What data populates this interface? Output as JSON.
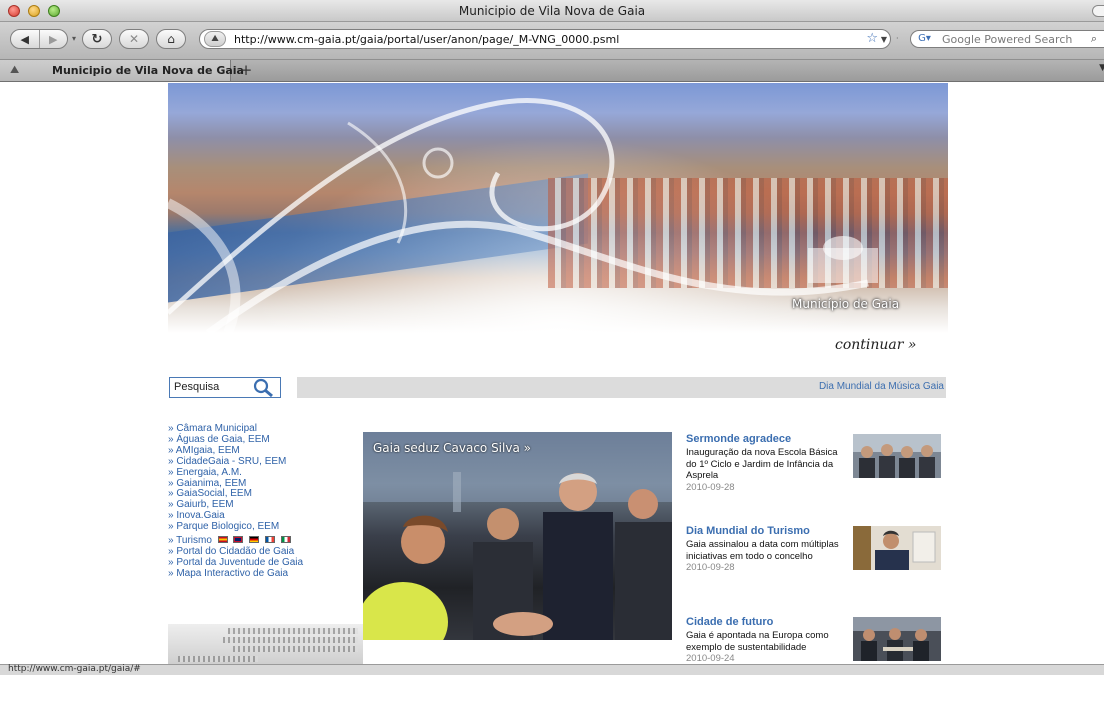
{
  "window": {
    "title": "Municipio de Vila Nova de Gaia",
    "url": "http://www.cm-gaia.pt/gaia/portal/user/anon/page/_M-VNG_0000.psml",
    "search_placeholder": "Google Powered Search",
    "tab_label": "Municipio de Vila Nova de Gaia",
    "new_tab": "+",
    "status": "http://www.cm-gaia.pt/gaia/#"
  },
  "page": {
    "hero_caption": "Município de Gaia",
    "continue_label": "continuar »",
    "search_value": "Pesquisa",
    "ticker": "Dia Mundial da Música  Gaia",
    "nav": [
      "» Câmara Municipal",
      "» Águas de Gaia, EEM",
      "» AMIgaia, EEM",
      "» CidadeGaia - SRU, EEM",
      "» Energaia, A.M.",
      "» Gaianima, EEM",
      "» GaiaSocial, EEM",
      "» Gaiurb, EEM",
      "» Inova.Gaia",
      "» Parque Biologico, EEM",
      "» Turismo",
      "» Portal do Cidadão de Gaia",
      "» Portal da Juventude de Gaia",
      "» Mapa Interactivo de Gaia"
    ],
    "flag_colors": [
      "#e8b500",
      "#2a3f8f",
      "#222222",
      "#3b5fb0",
      "#2f9a3c"
    ],
    "feature_caption": "Gaia seduz Cavaco Silva »",
    "news": [
      {
        "title": "Sermonde agradece",
        "body": "Inauguração da nova Escola Básica do 1º Ciclo e Jardim de Infância da Asprela",
        "date": "2010-09-28"
      },
      {
        "title": "Dia Mundial do Turismo",
        "body": "Gaia assinalou a data com múltiplas iniciativas em todo o concelho",
        "date": "2010-09-28"
      },
      {
        "title": "Cidade de futuro",
        "body": "Gaia é apontada na Europa como exemplo de sustentabilidade",
        "date": "2010-09-24"
      }
    ]
  }
}
